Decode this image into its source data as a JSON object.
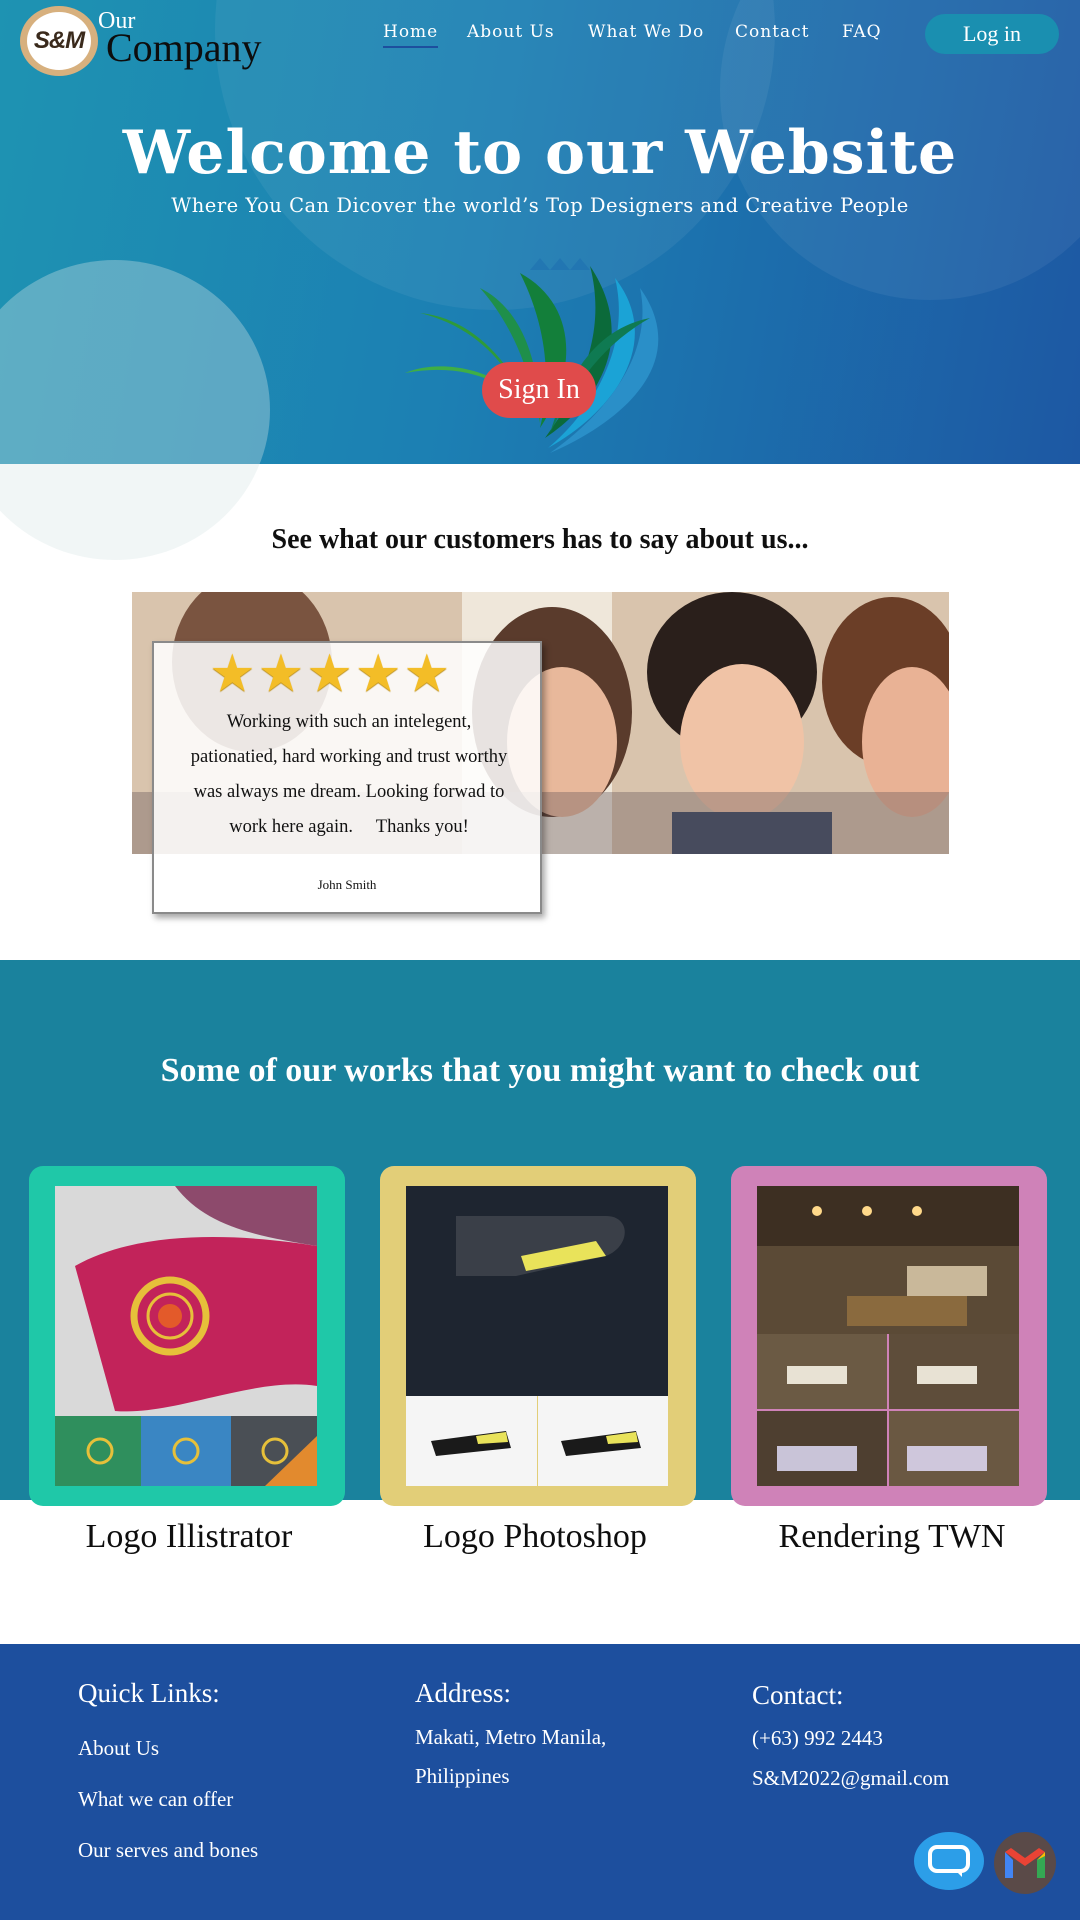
{
  "brand": {
    "badge": "S&M",
    "our": "Our",
    "company": "Company"
  },
  "nav": {
    "items": [
      {
        "label": "Home",
        "active": true
      },
      {
        "label": "About Us"
      },
      {
        "label": "What We Do"
      },
      {
        "label": "Contact"
      },
      {
        "label": "FAQ"
      }
    ],
    "login_label": "Log in"
  },
  "hero": {
    "title": "Welcome to our Website",
    "subtitle": "Where You Can Dicover the world’s Top Designers and Creative People",
    "signin_label": "Sign In"
  },
  "testimonial": {
    "heading": "See what our customers has to say about us...",
    "rating": 5,
    "text_lines": [
      "Working with such an intelegent,",
      "pationatied, hard working and trust worthy",
      "was always me dream. Looking forwad to",
      "work here again.     Thanks you!"
    ],
    "author": "John Smith"
  },
  "works": {
    "heading": "Some of our works that you might want to check out",
    "items": [
      {
        "label": "Logo Illistrator",
        "color": "#1fc8a8"
      },
      {
        "label": "Logo Photoshop",
        "color": "#e2ce78"
      },
      {
        "label": "Rendering TWN",
        "color": "#cf82b8"
      }
    ]
  },
  "footer": {
    "quick_links": {
      "title": "Quick Links:",
      "items": [
        "About Us",
        "What we can offer",
        "Our serves and bones"
      ]
    },
    "address": {
      "title": "Address:",
      "lines": [
        "Makati, Metro Manila,",
        "Philippines"
      ]
    },
    "contact": {
      "title": "Contact:",
      "phone": "(+63) 992 2443",
      "email": "S&M2022@gmail.com"
    }
  },
  "colors": {
    "hero_start": "#1e93b2",
    "hero_end": "#1d58a3",
    "signin": "#e04b4b",
    "works_bg": "#1a829d",
    "footer_bg": "#1d4f9e",
    "star": "#f3bd27"
  },
  "icons": [
    "chat-icon",
    "gmail-icon",
    "star-icon"
  ]
}
